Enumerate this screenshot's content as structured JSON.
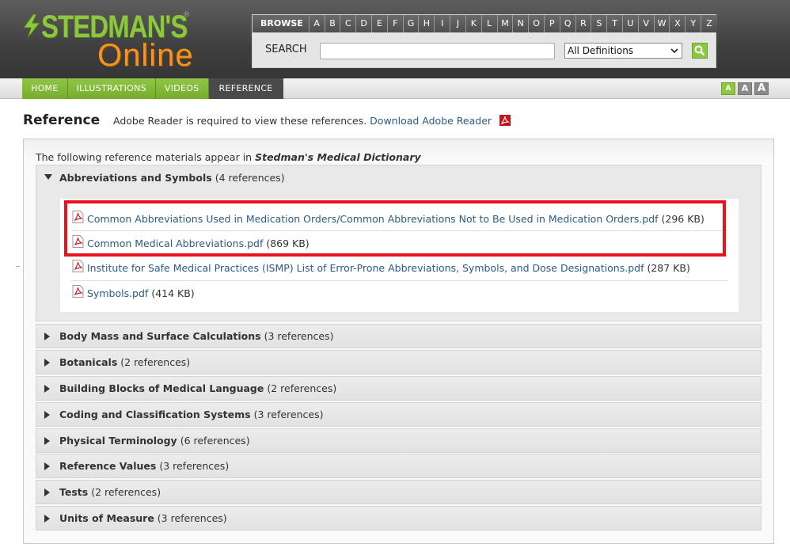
{
  "header": {
    "logo_top": "STEDMAN'S",
    "logo_reg": "®",
    "logo_bottom": "Online",
    "browse_label": "BROWSE",
    "letters": [
      "A",
      "B",
      "C",
      "D",
      "E",
      "F",
      "G",
      "H",
      "I",
      "J",
      "K",
      "L",
      "M",
      "N",
      "O",
      "P",
      "Q",
      "R",
      "S",
      "T",
      "U",
      "V",
      "W",
      "X",
      "Y",
      "Z"
    ],
    "search_label": "SEARCH",
    "search_value": "",
    "search_scope": "All Definitions"
  },
  "nav": {
    "tabs": [
      "HOME",
      "ILLUSTRATIONS",
      "VIDEOS",
      "REFERENCE"
    ],
    "active": "REFERENCE",
    "font_sizes": [
      "A",
      "A",
      "A"
    ]
  },
  "page": {
    "title": "Reference",
    "adobe_note": "Adobe Reader is required to view these references.",
    "adobe_link": "Download Adobe Reader"
  },
  "panel": {
    "intro": "The following reference materials appear in",
    "intro_source": "Stedman's Medical Dictionary",
    "open_section": {
      "title": "Abbreviations and Symbols",
      "count": "(4 references)",
      "items": [
        {
          "name": "Common Abbreviations Used in Medication Orders/Common Abbreviations Not to Be Used in Medication Orders.pdf",
          "size": "(296 KB)"
        },
        {
          "name": "Common Medical Abbreviations.pdf",
          "size": "(869 KB)"
        },
        {
          "name": "Institute for Safe Medical Practices (ISMP) List of Error-Prone Abbreviations, Symbols, and Dose Designations.pdf",
          "size": "(287 KB)"
        },
        {
          "name": "Symbols.pdf",
          "size": "(414 KB)"
        }
      ]
    },
    "sections": [
      {
        "title": "Body Mass and Surface Calculations",
        "count": "(3 references)"
      },
      {
        "title": "Botanicals",
        "count": "(2 references)"
      },
      {
        "title": "Building Blocks of Medical Language",
        "count": "(2 references)"
      },
      {
        "title": "Coding and Classification Systems",
        "count": "(3 references)"
      },
      {
        "title": "Physical Terminology",
        "count": "(6 references)"
      },
      {
        "title": "Reference Values",
        "count": "(3 references)"
      },
      {
        "title": "Tests",
        "count": "(2 references)"
      },
      {
        "title": "Units of Measure",
        "count": "(3 references)"
      }
    ]
  },
  "colors": {
    "brand_green": "#8dc63f",
    "brand_orange": "#f7941d",
    "link": "#2a5a8a",
    "highlight": "#e8111d"
  },
  "icons": [
    "pdf-icon",
    "search-icon",
    "triangle-down-icon",
    "triangle-right-icon",
    "chevron-down-icon"
  ]
}
